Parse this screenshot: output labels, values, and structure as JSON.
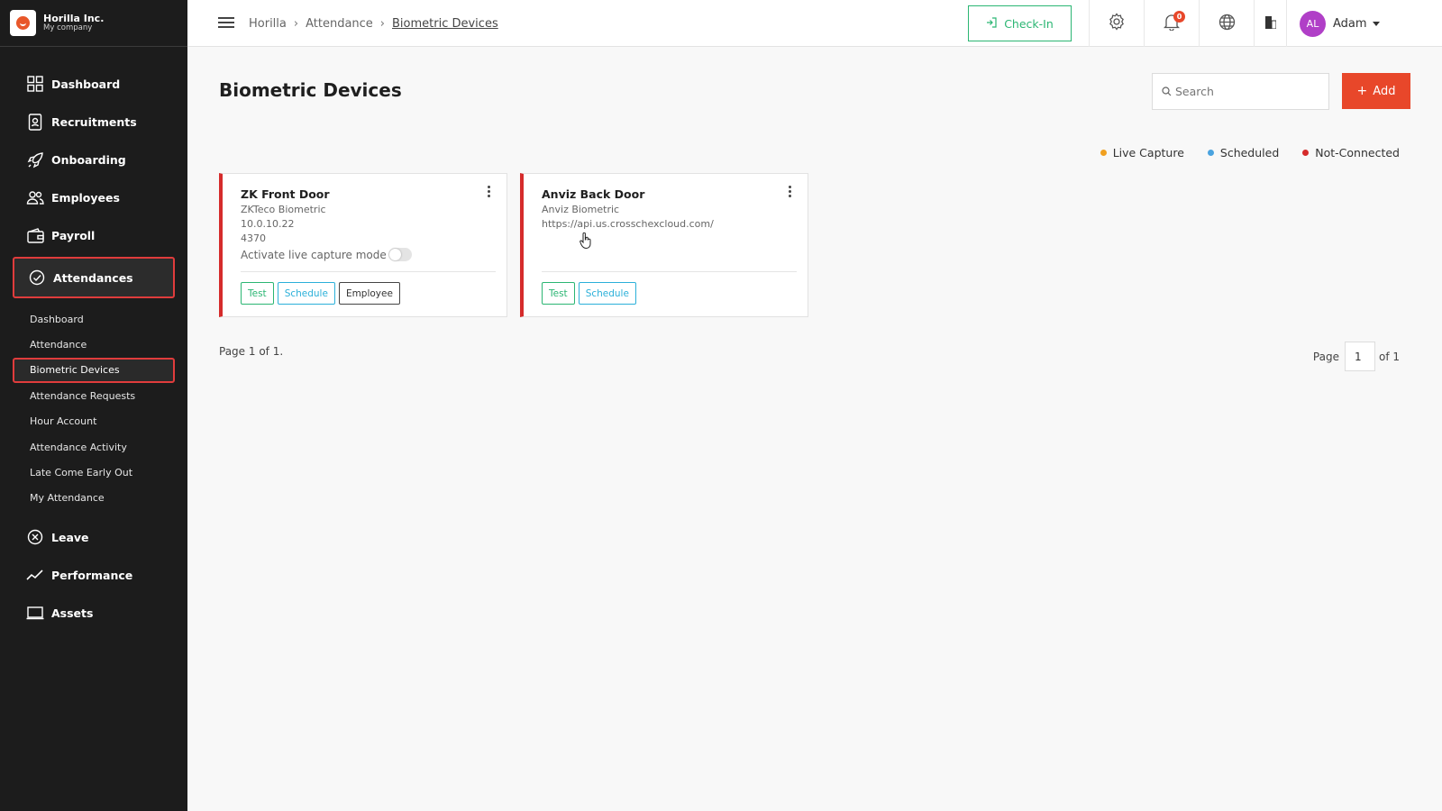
{
  "brand": {
    "name": "Horilla Inc.",
    "company": "My company"
  },
  "sidebar": {
    "items": [
      {
        "label": "Dashboard",
        "icon": "grid-icon"
      },
      {
        "label": "Recruitments",
        "icon": "id-badge-icon"
      },
      {
        "label": "Onboarding",
        "icon": "rocket-icon"
      },
      {
        "label": "Employees",
        "icon": "people-icon"
      },
      {
        "label": "Payroll",
        "icon": "wallet-icon"
      },
      {
        "label": "Attendances",
        "icon": "check-circle-icon"
      },
      {
        "label": "Leave",
        "icon": "x-circle-icon"
      },
      {
        "label": "Performance",
        "icon": "trend-icon"
      },
      {
        "label": "Assets",
        "icon": "laptop-icon"
      }
    ],
    "attendance_sub": [
      "Dashboard",
      "Attendance",
      "Biometric Devices",
      "Attendance Requests",
      "Hour Account",
      "Attendance Activity",
      "Late Come Early Out",
      "My Attendance"
    ]
  },
  "header": {
    "breadcrumb": [
      "Horilla",
      "Attendance",
      "Biometric Devices"
    ],
    "checkin_label": "Check-In",
    "notification_count": "0",
    "user": {
      "initials": "AL",
      "name": "Adam"
    }
  },
  "main": {
    "title": "Biometric Devices",
    "search_placeholder": "Search",
    "add_label": "Add",
    "legend": [
      {
        "label": "Live Capture",
        "color": "#f0a020"
      },
      {
        "label": "Scheduled",
        "color": "#4aa3df"
      },
      {
        "label": "Not-Connected",
        "color": "#d52b2b"
      }
    ],
    "devices": [
      {
        "name": "ZK Front Door",
        "type": "ZKTeco Biometric",
        "ip": "10.0.10.22",
        "port": "4370",
        "live_capture_label": "Activate live capture mode",
        "actions": [
          "Test",
          "Schedule",
          "Employee"
        ]
      },
      {
        "name": "Anviz Back Door",
        "type": "Anviz Biometric",
        "url": "https://api.us.crosschexcloud.com/",
        "actions": [
          "Test",
          "Schedule"
        ]
      }
    ],
    "page_info": "Page 1 of 1.",
    "pager": {
      "label": "Page",
      "current": "1",
      "total": "of 1"
    }
  },
  "colors": {
    "accent": "#e8472a",
    "checkin": "#2bb673",
    "sidebar_bg": "#1c1c1c",
    "highlight": "#e03c3c"
  }
}
